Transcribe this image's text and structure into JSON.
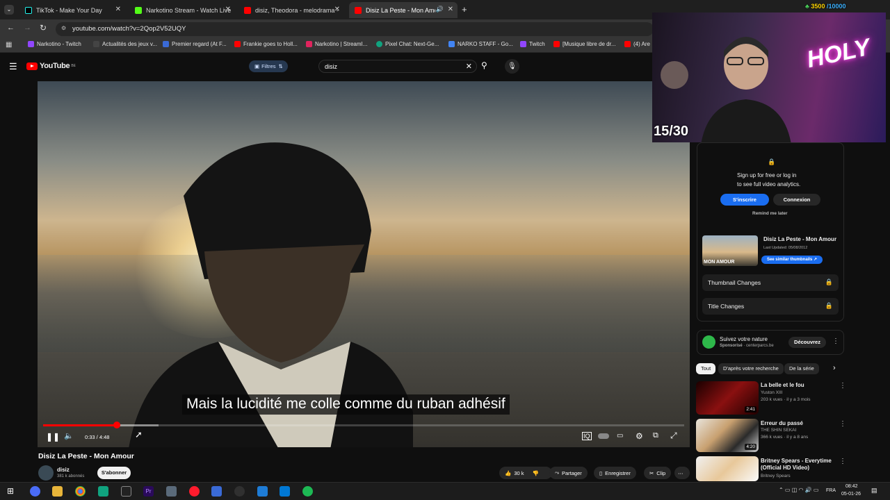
{
  "browser": {
    "tabs": [
      {
        "title": "TikTok - Make Your Day",
        "active": false
      },
      {
        "title": "Narkotino Stream - Watch Live",
        "active": false
      },
      {
        "title": "disiz, Theodora - melodrama -",
        "active": false
      },
      {
        "title": "Disiz La Peste - Mon Amour",
        "active": true
      }
    ],
    "url": "youtube.com/watch?v=2Qop2V52UQY",
    "bookmarks": [
      "Narkotino - Twitch",
      "Actualités des jeux v...",
      "Premier regard (At F...",
      "Frankie goes to Holl...",
      "Narkotino | StreamI...",
      "Pixel Chat: Next-Ge...",
      "NARKO STAFF - Go...",
      "Twitch",
      "[Musique libre de dr...",
      "(4) Are"
    ]
  },
  "youtube": {
    "logo_text": "YouTube",
    "logo_region": "BE",
    "filters_label": "Filtres",
    "search_value": "disiz"
  },
  "video": {
    "subtitle": "Mais la lucidité me colle comme du ruban adhésif",
    "time": "0:33 / 4:48",
    "progress_fraction": 0.115,
    "buffered_fraction": 0.18,
    "title": "Disiz La Peste - Mon Amour",
    "channel_name": "disiz",
    "subscribers": "381 k abonnés",
    "subscribe_label": "S'abonner",
    "likes": "30 k",
    "share_label": "Partager",
    "save_label": "Enregistrer",
    "clip_label": "Clip"
  },
  "webcam": {
    "neon_text": "HOLY",
    "counter": "15/30"
  },
  "overlay_top": {
    "count_a": "3500",
    "count_b": "10000"
  },
  "analytics": {
    "signup_line1": "Sign up for free or log in",
    "signup_line2": "to see full video analytics.",
    "register_label": "S'inscrire",
    "login_label": "Connexion",
    "remind_label": "Remind me later",
    "video_title": "Disiz La Peste - Mon Amour",
    "last_updated": "Last Updated: 05/08/2012",
    "similar_label": "See similar thumbnails",
    "thumb_caption": "MON AMOUR",
    "thumbnail_changes": "Thumbnail Changes",
    "title_changes": "Title Changes"
  },
  "ad": {
    "title": "Suivez votre nature",
    "sponsored": "Sponsorisé",
    "domain": "centerparcs.be",
    "cta": "Découvrez"
  },
  "chips": [
    "Tout",
    "D'après votre recherche",
    "De la série"
  ],
  "recommendations": [
    {
      "title": "La belle et le fou",
      "channel": "Yuston XIII",
      "meta": "203 k vues · il y a 3 mois",
      "duration": "2:41"
    },
    {
      "title": "Erreur du passé",
      "channel": "THE SHIN SEKAI",
      "meta": "366 k vues · il y a 8 ans",
      "duration": "4:20"
    },
    {
      "title": "Britney Spears - Everytime (Official HD Video)",
      "channel": "Britney Spears",
      "meta": "",
      "duration": ""
    }
  ],
  "taskbar": {
    "lang": "FRA",
    "time": "08:42",
    "date": "05-01-26"
  },
  "colors": {
    "yt_red": "#ff0000",
    "accent_blue": "#1a6df0",
    "background": "#0f0f0f"
  }
}
